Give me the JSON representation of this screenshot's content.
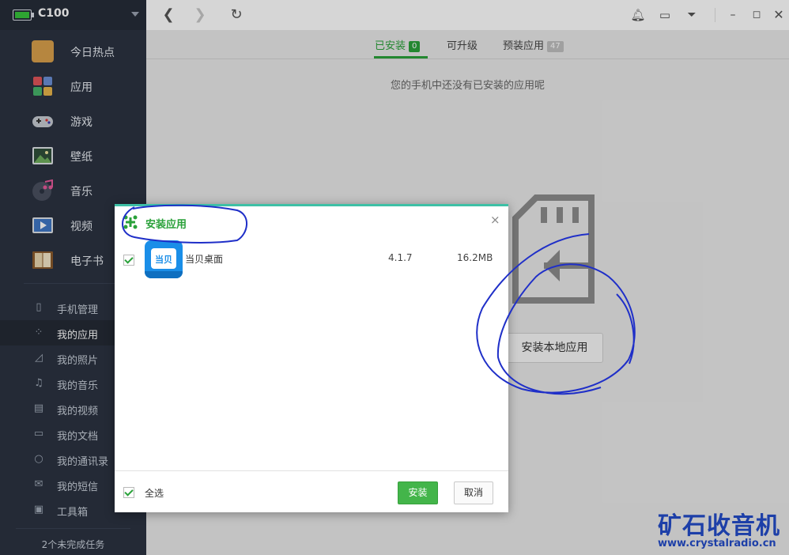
{
  "sidebar": {
    "device_name": "C100",
    "categories": [
      {
        "label": "今日热点",
        "icon": "shopping-bag-icon",
        "color": "#d9a04c"
      },
      {
        "label": "应用",
        "icon": "apps-grid-icon",
        "color": "#6a8fd6"
      },
      {
        "label": "游戏",
        "icon": "gamepad-icon",
        "color": "#c6cbd2"
      },
      {
        "label": "壁纸",
        "icon": "picture-icon",
        "color": "#4a7d4f"
      },
      {
        "label": "音乐",
        "icon": "music-disc-icon",
        "color": "#5a5f6e"
      },
      {
        "label": "视频",
        "icon": "video-play-icon",
        "color": "#3f77c5"
      },
      {
        "label": "电子书",
        "icon": "book-icon",
        "color": "#b4793b"
      }
    ],
    "sections": [
      {
        "label": "手机管理",
        "icon": "phone-icon"
      },
      {
        "label": "我的应用",
        "icon": "grid-icon",
        "active": true
      },
      {
        "label": "我的照片",
        "icon": "photo-icon"
      },
      {
        "label": "我的音乐",
        "icon": "note-icon"
      },
      {
        "label": "我的视频",
        "icon": "film-icon"
      },
      {
        "label": "我的文档",
        "icon": "open-book-icon"
      },
      {
        "label": "我的通讯录",
        "icon": "person-icon"
      },
      {
        "label": "我的短信",
        "icon": "envelope-icon"
      },
      {
        "label": "工具箱",
        "icon": "toolbox-icon"
      }
    ],
    "tasks_text": "2个未完成任务"
  },
  "tabs": [
    {
      "label": "已安装",
      "count": "0",
      "active": true
    },
    {
      "label": "可升级",
      "count": ""
    },
    {
      "label": "预装应用",
      "count": "47"
    }
  ],
  "empty_message": "您的手机中还没有已安装的应用呢",
  "install_local_button": "安装本地应用",
  "dialog": {
    "title": "安装应用",
    "close_glyph": "×",
    "app": {
      "name": "当贝桌面",
      "version": "4.1.7",
      "size": "16.2MB",
      "icon_text": "当贝",
      "checked": true
    },
    "select_all_label": "全选",
    "install_button": "安装",
    "cancel_button": "取消"
  },
  "watermark": {
    "text_cn": "矿石收音机",
    "url": "www.crystalradio.cn"
  },
  "colors": {
    "accent_green": "#2aa13a",
    "sidebar_bg": "#2b3341",
    "annotation_blue": "#1f2fc8"
  }
}
